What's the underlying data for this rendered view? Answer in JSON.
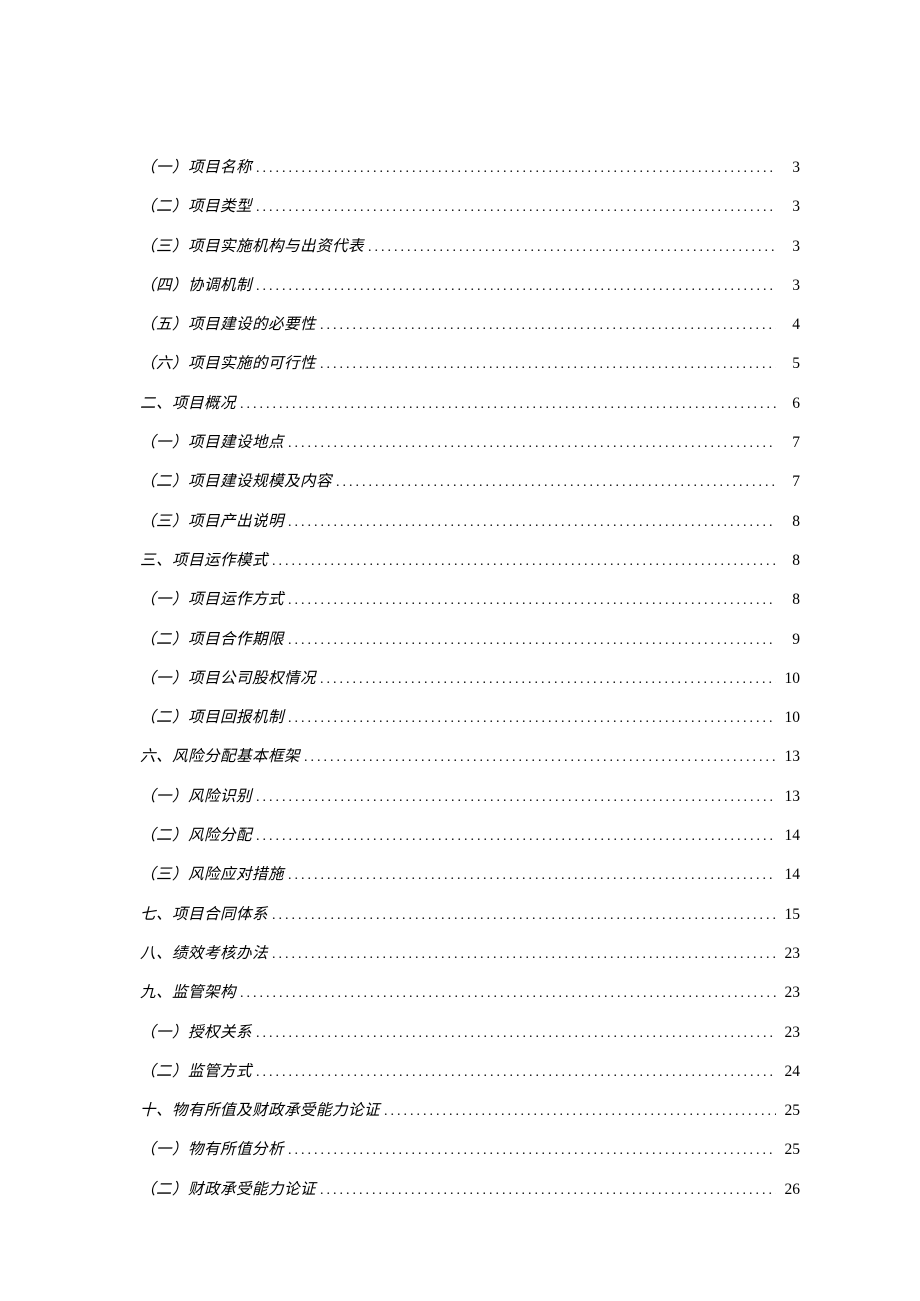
{
  "toc": {
    "entries": [
      {
        "title": "（一）项目名称",
        "page": "3"
      },
      {
        "title": "（二）项目类型",
        "page": "3"
      },
      {
        "title": "（三）项目实施机构与出资代表",
        "page": "3"
      },
      {
        "title": "（四）协调机制",
        "page": "3"
      },
      {
        "title": "（五）项目建设的必要性",
        "page": "4"
      },
      {
        "title": "（六）项目实施的可行性",
        "page": "5"
      },
      {
        "title": "二、项目概况",
        "page": "6"
      },
      {
        "title": "（一）项目建设地点",
        "page": "7"
      },
      {
        "title": "（二）项目建设规模及内容",
        "page": "7"
      },
      {
        "title": "（三）项目产出说明",
        "page": "8"
      },
      {
        "title": "三、项目运作模式",
        "page": "8"
      },
      {
        "title": "（一）项目运作方式",
        "page": "8"
      },
      {
        "title": "（二）项目合作期限",
        "page": "9"
      },
      {
        "title": "（一）项目公司股权情况",
        "page": "10"
      },
      {
        "title": "（二）项目回报机制",
        "page": "10"
      },
      {
        "title": "六、风险分配基本框架",
        "page": "13"
      },
      {
        "title": "（一）风险识别",
        "page": "13"
      },
      {
        "title": "（二）风险分配",
        "page": "14"
      },
      {
        "title": "（三）风险应对措施",
        "page": "14"
      },
      {
        "title": "七、项目合同体系",
        "page": "15"
      },
      {
        "title": "八、绩效考核办法",
        "page": "23"
      },
      {
        "title": "九、监管架构",
        "page": "23"
      },
      {
        "title": "（一）授权关系",
        "page": "23"
      },
      {
        "title": "（二）监管方式",
        "page": "24"
      },
      {
        "title": "十、物有所值及财政承受能力论证",
        "page": "25"
      },
      {
        "title": "（一）物有所值分析",
        "page": "25"
      },
      {
        "title": "（二）财政承受能力论证",
        "page": "26"
      }
    ]
  }
}
